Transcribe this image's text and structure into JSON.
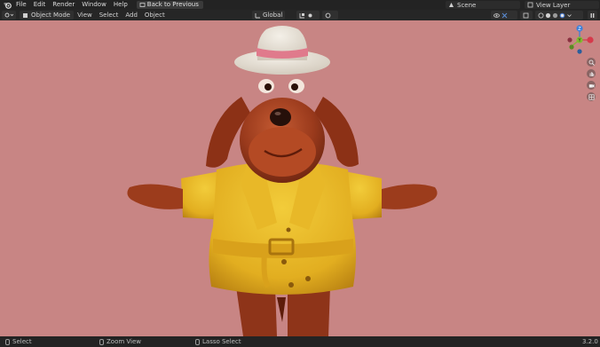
{
  "menubar": {
    "items": [
      "File",
      "Edit",
      "Render",
      "Window",
      "Help"
    ],
    "back_button": "Back to Previous",
    "scene_name": "Scene",
    "view_layer_name": "View Layer"
  },
  "viewport_header": {
    "mode": "Object Mode",
    "menus": [
      "View",
      "Select",
      "Add",
      "Object"
    ],
    "transform_orientation": "Global"
  },
  "gizmo": {
    "axes": {
      "x": "X",
      "y": "Y",
      "z": "Z"
    },
    "colors": {
      "x": "#d6394b",
      "y": "#7fba2f",
      "z": "#3c7fd8"
    }
  },
  "statusbar": {
    "left": "Select",
    "middle": "Zoom View",
    "right_action": "Lasso Select",
    "version": "3.2.0"
  },
  "icons": [
    "blender-logo-icon",
    "editor-type-icon",
    "object-mode-icon",
    "transform-orientation-icon",
    "snap-icon",
    "proportional-edit-icon",
    "zoom-icon",
    "hand-pan-icon",
    "camera-icon",
    "grid-icon"
  ],
  "viewport": {
    "background": "#c88584"
  }
}
